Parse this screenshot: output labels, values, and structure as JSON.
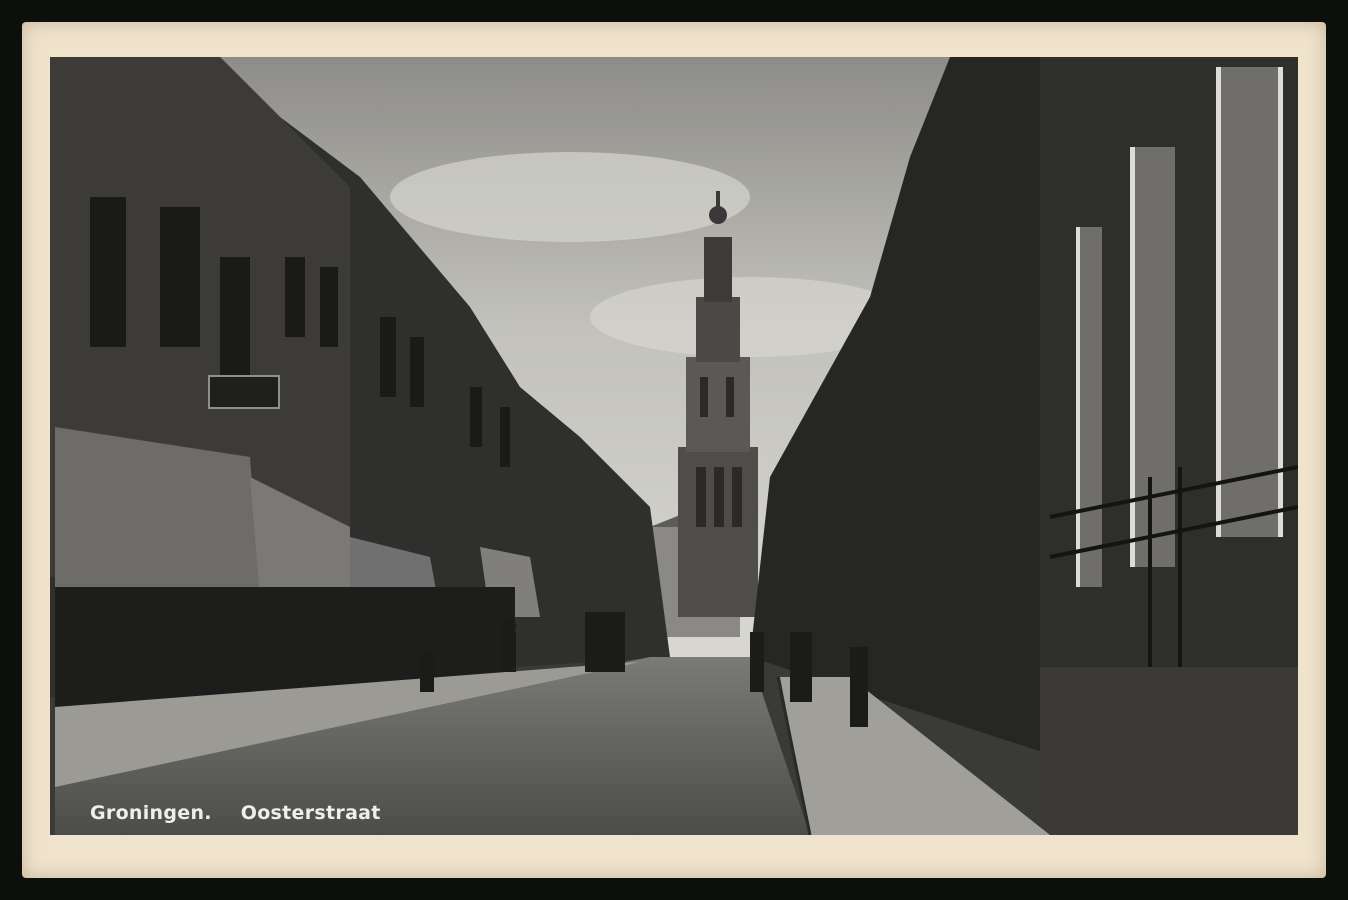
{
  "caption": {
    "city": "Groningen.",
    "street": "Oosterstraat"
  },
  "colors": {
    "card_border": "#efe3cc",
    "sky": "#b8b7b1",
    "street": "#5b5b58",
    "buildings_dark": "#2a2a28"
  }
}
